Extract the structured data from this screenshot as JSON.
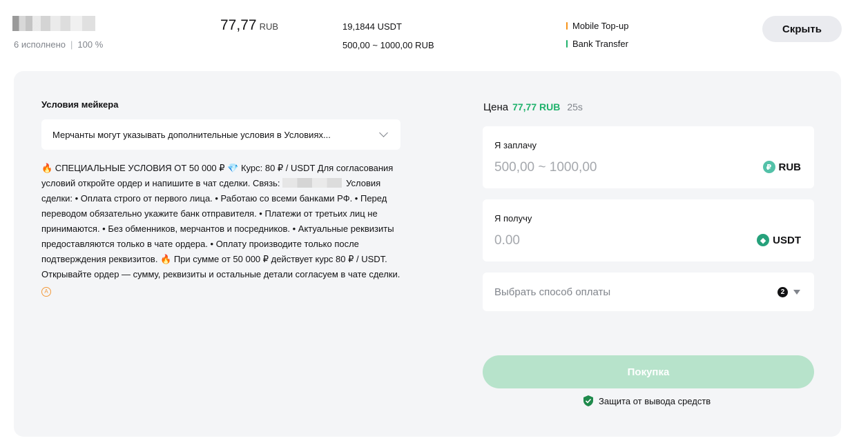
{
  "merchant": {
    "stats_orders": "6 исполнено",
    "stats_sep": "|",
    "stats_rate": "100 %"
  },
  "listing": {
    "price": "77,77",
    "price_currency": "RUB",
    "available": "19,1844 USDT",
    "limits": "500,00 ~ 1000,00 RUB",
    "methods": [
      {
        "label": "Mobile Top-up",
        "color": "#f7931a"
      },
      {
        "label": "Bank Transfer",
        "color": "#20b26c"
      }
    ],
    "hide_label": "Скрыть"
  },
  "conditions": {
    "title": "Условия мейкера",
    "select_text": "Мерчанты могут указывать дополнительные условия в Условиях...",
    "terms_part1": " СПЕЦИАЛЬНЫЕ УСЛОВИЯ ОТ 50 000 ₽ ",
    "terms_part2": " Курс: 80 ₽ / USDT Для согласования условий откройте ордер и напишите в чат сделки. Связь: ",
    "terms_part3": "Условия сделки: • Оплата строго от первого лица. • Работаю со всеми банками РФ. • Перед переводом обязательно укажите банк отправителя. • Платежи от третьих лиц не принимаются. • Без обменников, мерчантов и посредников. • Актуальные реквизиты предоставляются только в чате ордера. • Оплату производите только после подтверждения реквизитов. ",
    "terms_part4": " При сумме от 50 000 ₽ действует курс 80 ₽ / USDT. Открывайте ордер — сумму, реквизиты и остальные детали согласуем в чате сделки. "
  },
  "order": {
    "price_label": "Цена",
    "price_value": "77,77 RUB",
    "timer": "25s",
    "pay_label": "Я заплачу",
    "pay_placeholder": "500,00 ~ 1000,00",
    "pay_currency": "RUB",
    "receive_label": "Я получу",
    "receive_placeholder": "0.00",
    "receive_currency": "USDT",
    "method_placeholder": "Выбрать способ оплаты",
    "method_count": "2",
    "buy_label": "Покупка",
    "protection": "Защита от вывода средств"
  }
}
